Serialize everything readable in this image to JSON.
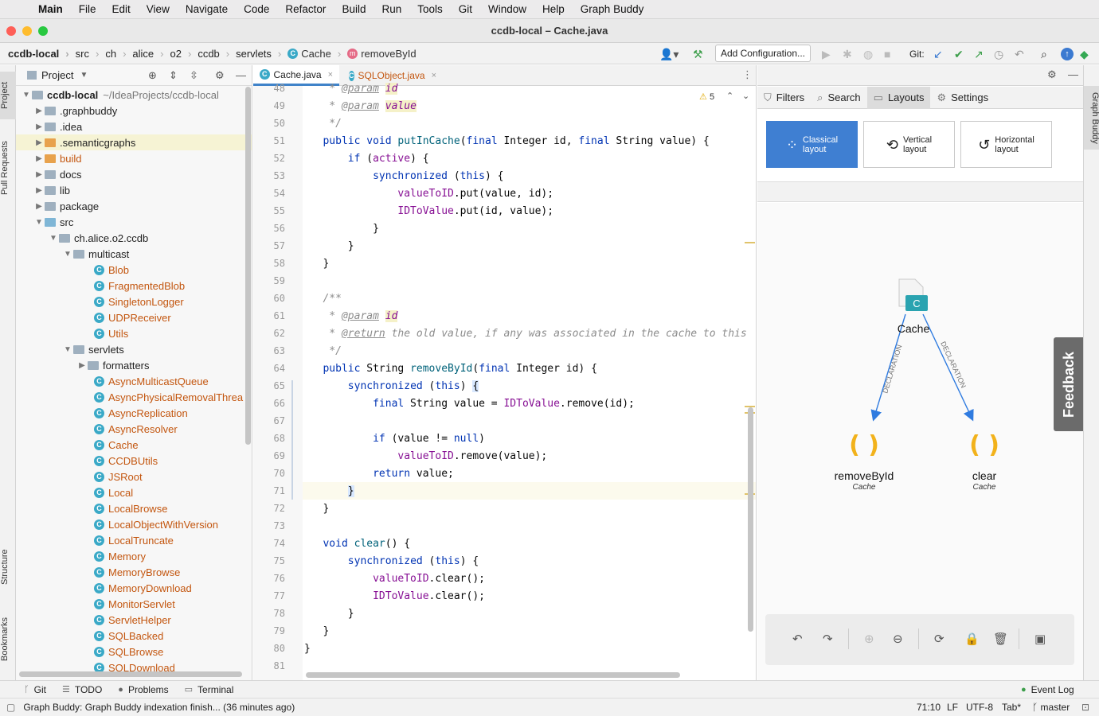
{
  "menubar": {
    "app": "Main",
    "items": [
      "File",
      "Edit",
      "View",
      "Navigate",
      "Code",
      "Refactor",
      "Build",
      "Run",
      "Tools",
      "Git",
      "Window",
      "Help",
      "Graph Buddy"
    ]
  },
  "window": {
    "title": "ccdb-local – Cache.java"
  },
  "breadcrumbs": {
    "project": "ccdb-local",
    "items": [
      "src",
      "ch",
      "alice",
      "o2",
      "ccdb",
      "servlets"
    ],
    "class": "Cache",
    "method": "removeById"
  },
  "toolbar": {
    "add_configuration": "Add Configuration...",
    "git_label": "Git:"
  },
  "left_strip": {
    "project": "Project",
    "pull_requests": "Pull Requests",
    "structure": "Structure",
    "bookmarks": "Bookmarks"
  },
  "right_strip": {
    "graph_buddy": "Graph Buddy"
  },
  "project_panel": {
    "title": "Project",
    "root": "ccdb-local",
    "root_path": "~/IdeaProjects/ccdb-local",
    "folders_top": [
      ".graphbuddy",
      ".idea",
      ".semanticgraphs",
      "build",
      "docs",
      "lib",
      "package",
      "src"
    ],
    "package": "ch.alice.o2.ccdb",
    "multicast": "multicast",
    "multicast_classes": [
      "Blob",
      "FragmentedBlob",
      "SingletonLogger",
      "UDPReceiver",
      "Utils"
    ],
    "servlets": "servlets",
    "formatters": "formatters",
    "servlet_classes": [
      "AsyncMulticastQueue",
      "AsyncPhysicalRemovalThrea",
      "AsyncReplication",
      "AsyncResolver",
      "Cache",
      "CCDBUtils",
      "JSRoot",
      "Local",
      "LocalBrowse",
      "LocalObjectWithVersion",
      "LocalTruncate",
      "Memory",
      "MemoryBrowse",
      "MemoryDownload",
      "MonitorServlet",
      "ServletHelper",
      "SQLBacked",
      "SQLBrowse",
      "SQLDownload"
    ]
  },
  "editor": {
    "tabs": [
      "Cache.java",
      "SQLObject.java"
    ],
    "warnings": "5",
    "line_numbers": [
      "48",
      "49",
      "50",
      "51",
      "52",
      "53",
      "54",
      "55",
      "56",
      "57",
      "58",
      "59",
      "60",
      "61",
      "62",
      "63",
      "64",
      "65",
      "66",
      "67",
      "68",
      "69",
      "70",
      "71",
      "72",
      "73",
      "74",
      "75",
      "76",
      "77",
      "78",
      "79",
      "80",
      "81"
    ]
  },
  "graph_buddy": {
    "tabs": [
      "Filters",
      "Search",
      "Layouts",
      "Settings"
    ],
    "layouts": [
      {
        "line1": "Classical",
        "line2": "layout"
      },
      {
        "line1": "Vertical",
        "line2": "layout"
      },
      {
        "line1": "Horizontal",
        "line2": "layout"
      }
    ],
    "graph": {
      "root": {
        "label": "Cache",
        "icon_letter": "C"
      },
      "edge_label": "DECLARATION",
      "children": [
        {
          "label": "removeById",
          "sublabel": "Cache"
        },
        {
          "label": "clear",
          "sublabel": "Cache"
        }
      ]
    },
    "feedback": "Feedback"
  },
  "bottom_tabs": [
    "Git",
    "TODO",
    "Problems",
    "Terminal"
  ],
  "event_log": "Event Log",
  "status": {
    "message": "Graph Buddy: Graph Buddy indexation finish... (36 minutes ago)",
    "position": "71:10",
    "line_sep": "LF",
    "encoding": "UTF-8",
    "indent": "Tab*",
    "branch": "master"
  }
}
